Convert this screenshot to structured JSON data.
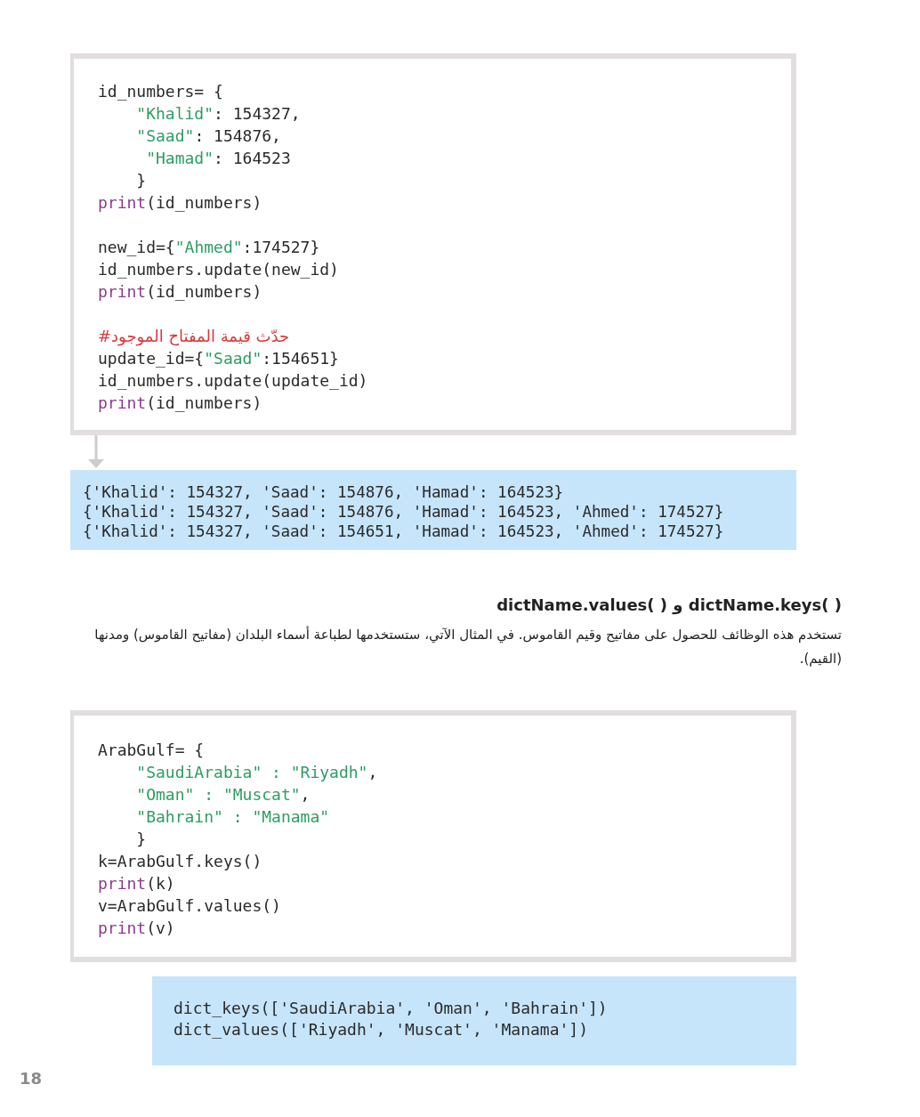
{
  "code_block_1": {
    "blocks": [
      [
        [
          {
            "text": "id_numbers= {",
            "kind": "plain"
          }
        ],
        [
          {
            "text": "    \"Khalid\"",
            "kind": "string"
          },
          {
            "text": ": 154327,",
            "kind": "plain"
          }
        ],
        [
          {
            "text": "    \"Saad\"",
            "kind": "string"
          },
          {
            "text": ": 154876,",
            "kind": "plain"
          }
        ],
        [
          {
            "text": "     \"Hamad\"",
            "kind": "string"
          },
          {
            "text": ": 164523",
            "kind": "plain"
          }
        ],
        [
          {
            "text": "    }",
            "kind": "plain"
          }
        ],
        [
          {
            "text": "print",
            "kind": "keyword"
          },
          {
            "text": "(id_numbers)",
            "kind": "plain"
          }
        ]
      ],
      [
        [
          {
            "text": "new_id={",
            "kind": "plain"
          },
          {
            "text": "\"Ahmed\"",
            "kind": "string"
          },
          {
            "text": ":174527}",
            "kind": "plain"
          }
        ],
        [
          {
            "text": "id_numbers.update(new_id)",
            "kind": "plain"
          }
        ],
        [
          {
            "text": "print",
            "kind": "keyword"
          },
          {
            "text": "(id_numbers)",
            "kind": "plain"
          }
        ]
      ],
      [
        [
          {
            "text": "#حدّث قيمة المفتاح الموجود",
            "kind": "comment"
          }
        ],
        [
          {
            "text": "update_id={",
            "kind": "plain"
          },
          {
            "text": "\"Saad\"",
            "kind": "string"
          },
          {
            "text": ":154651}",
            "kind": "plain"
          }
        ],
        [
          {
            "text": "id_numbers.update(update_id)",
            "kind": "plain"
          }
        ],
        [
          {
            "text": "print",
            "kind": "keyword"
          },
          {
            "text": "(id_numbers)",
            "kind": "plain"
          }
        ]
      ]
    ]
  },
  "output_1": [
    "{'Khalid': 154327, 'Saad': 154876, 'Hamad': 164523}",
    "{'Khalid': 154327, 'Saad': 154876, 'Hamad': 164523, 'Ahmed': 174527}",
    "{'Khalid': 154327, 'Saad': 154651, 'Hamad': 164523, 'Ahmed': 174527}"
  ],
  "section_heading": "dictName.values( ) و dictName.keys( )",
  "paragraph": "تستخدم هذه الوظائف للحصول على مفاتيح وقيم القاموس. في المثال الآتي، ستستخدمها لطباعة أسماء البلدان (مفاتيح القاموس) ومدنها (القيم).",
  "code_block_2": {
    "blocks": [
      [
        [
          {
            "text": "ArabGulf= {",
            "kind": "plain"
          }
        ],
        [
          {
            "text": "    \"SaudiArabia\" : \"Riyadh\"",
            "kind": "string"
          },
          {
            "text": ",",
            "kind": "plain"
          }
        ],
        [
          {
            "text": "    \"Oman\" : \"Muscat\"",
            "kind": "string"
          },
          {
            "text": ",",
            "kind": "plain"
          }
        ],
        [
          {
            "text": "    \"Bahrain\" : \"Manama\"",
            "kind": "string"
          }
        ],
        [
          {
            "text": "    }",
            "kind": "plain"
          }
        ],
        [
          {
            "text": "k=ArabGulf.keys()",
            "kind": "plain"
          }
        ],
        [
          {
            "text": "print",
            "kind": "keyword"
          },
          {
            "text": "(k)",
            "kind": "plain"
          }
        ],
        [
          {
            "text": "v=ArabGulf.values()",
            "kind": "plain"
          }
        ],
        [
          {
            "text": "print",
            "kind": "keyword"
          },
          {
            "text": "(v)",
            "kind": "plain"
          }
        ]
      ]
    ]
  },
  "output_2": [
    "dict_keys(['SaudiArabia', 'Oman', 'Bahrain'])",
    "dict_values(['Riyadh', 'Muscat', 'Manama'])"
  ],
  "page_number": "18"
}
